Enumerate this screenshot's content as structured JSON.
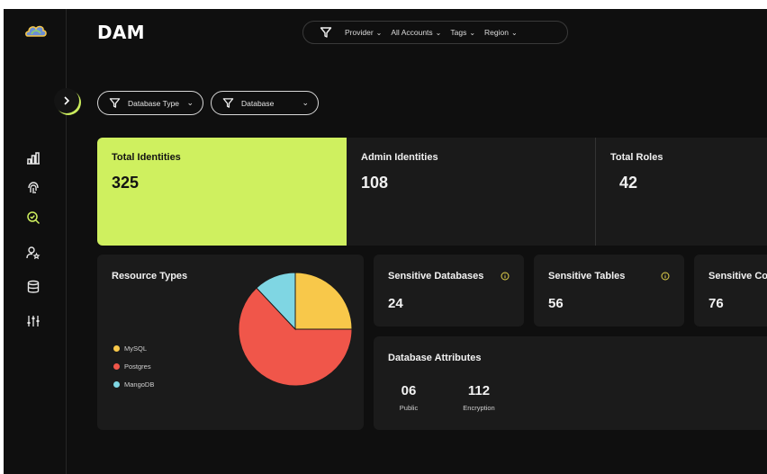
{
  "app": {
    "title": "DAM"
  },
  "sidebar": {
    "collapse_icon": "chevron-right-icon",
    "items": [
      {
        "icon": "chart-icon"
      },
      {
        "icon": "fingerprint-icon"
      },
      {
        "icon": "search-check-icon",
        "active": true
      },
      {
        "icon": "user-star-icon"
      },
      {
        "icon": "database-icon"
      },
      {
        "icon": "sliders-icon"
      }
    ]
  },
  "filters": {
    "items": [
      "Provider",
      "All Accounts",
      "Tags",
      "Region"
    ]
  },
  "pills": {
    "database_type": "Database Type",
    "database": "Database"
  },
  "stats": {
    "total_identities": {
      "label": "Total Identities",
      "value": "325"
    },
    "admin_identities": {
      "label": "Admin Identities",
      "value": "108"
    },
    "total_roles": {
      "label": "Total Roles",
      "value": "42"
    }
  },
  "resource_types": {
    "title": "Resource Types",
    "legend": [
      {
        "name": "MySQL",
        "color": "#f8c84a"
      },
      {
        "name": "Postgres",
        "color": "#f0564a"
      },
      {
        "name": "MangoDB",
        "color": "#7fd6e3"
      }
    ]
  },
  "chart_data": {
    "type": "pie",
    "labels": [
      "MySQL",
      "Postgres",
      "MangoDB"
    ],
    "values": [
      25,
      63,
      12
    ],
    "colors": [
      "#f8c84a",
      "#f0564a",
      "#7fd6e3"
    ]
  },
  "sensitive": {
    "databases": {
      "label": "Sensitive Databases",
      "value": "24"
    },
    "tables": {
      "label": "Sensitive Tables",
      "value": "56"
    },
    "columns": {
      "label": "Sensitive Col",
      "value": "76"
    }
  },
  "database_attributes": {
    "title": "Database Attributes",
    "metrics": [
      {
        "value": "06",
        "label": "Public"
      },
      {
        "value": "112",
        "label": "Encryption"
      }
    ]
  },
  "colors": {
    "accent": "#cff05f",
    "info": "#e3d24a"
  }
}
